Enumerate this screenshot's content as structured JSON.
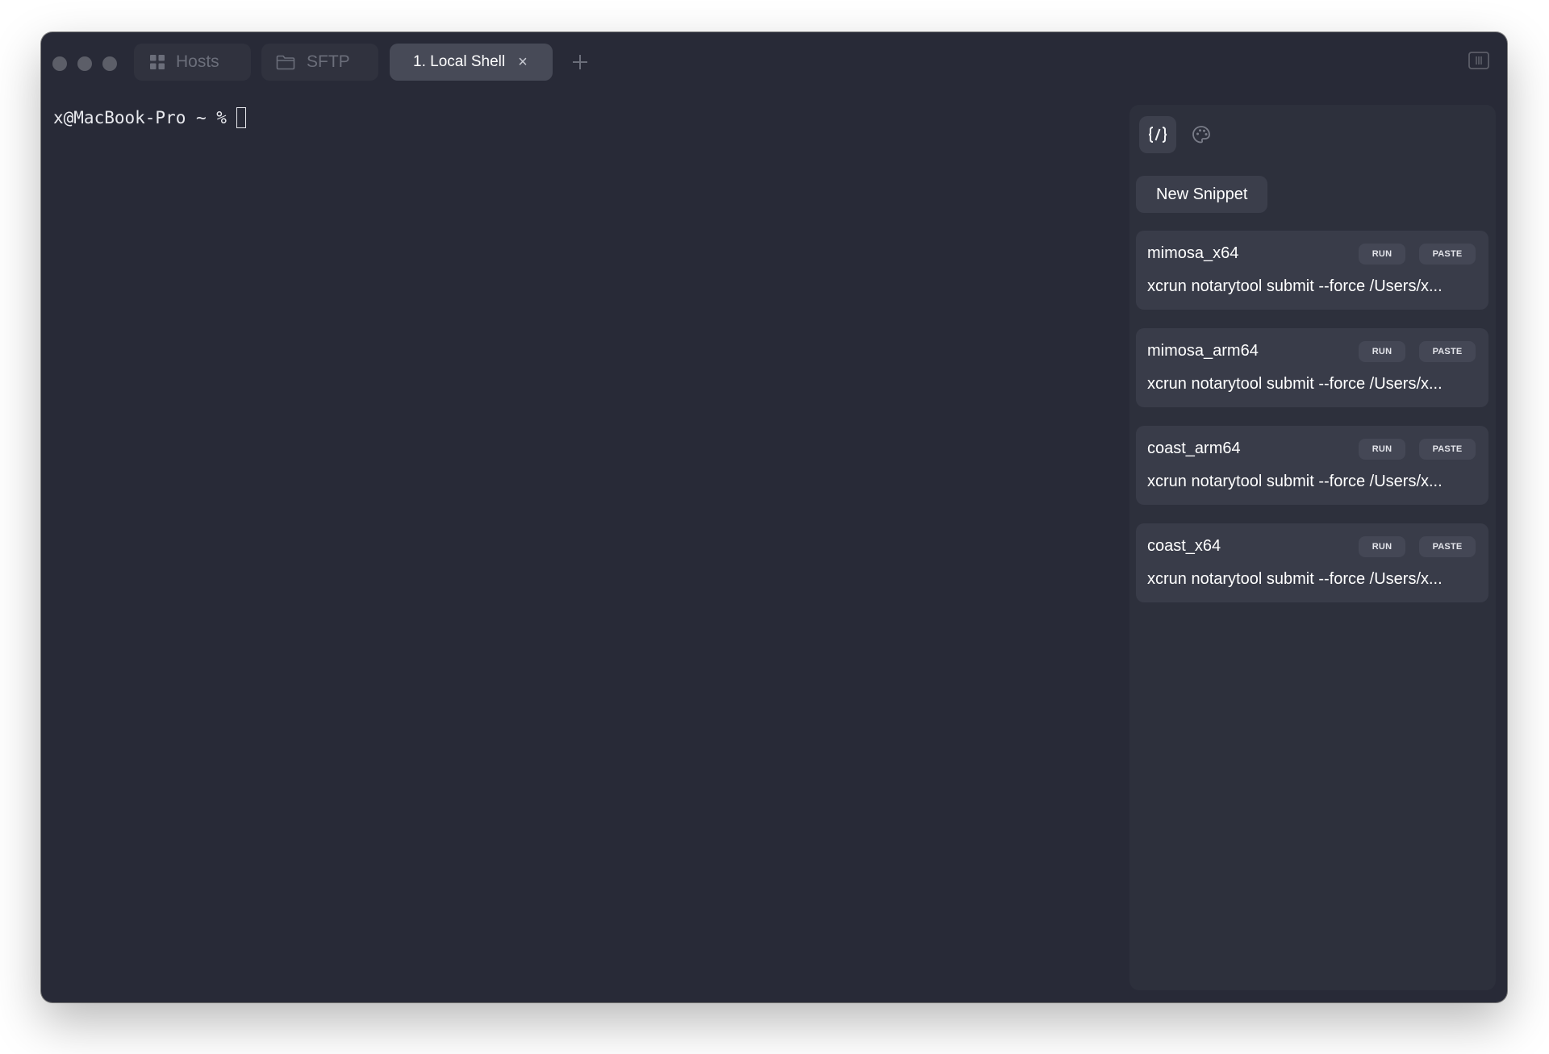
{
  "tabs": [
    {
      "label": "Hosts",
      "icon": "grid-icon"
    },
    {
      "label": "SFTP",
      "icon": "folder-icon"
    },
    {
      "label": "1. Local Shell",
      "close": "×"
    }
  ],
  "new_tab_icon": "plus-icon",
  "layout_icon": "split-layout-icon",
  "terminal": {
    "prompt": "x@MacBook-Pro ~ %"
  },
  "snippets_panel": {
    "tab_icons": [
      "code-snippet-icon",
      "palette-icon"
    ],
    "new_snippet_label": "New Snippet",
    "run_label": "RUN",
    "paste_label": "PASTE",
    "items": [
      {
        "name": "mimosa_x64",
        "command": "xcrun notarytool submit --force /Users/x..."
      },
      {
        "name": "mimosa_arm64",
        "command": "xcrun notarytool submit --force /Users/x..."
      },
      {
        "name": "coast_arm64",
        "command": "xcrun notarytool submit --force /Users/x..."
      },
      {
        "name": "coast_x64",
        "command": "xcrun notarytool submit --force /Users/x..."
      }
    ]
  },
  "colors": {
    "window_bg": "#282a37",
    "panel_bg": "#2d303c",
    "card_bg": "#393c49",
    "active_tab_bg": "#474a57"
  }
}
